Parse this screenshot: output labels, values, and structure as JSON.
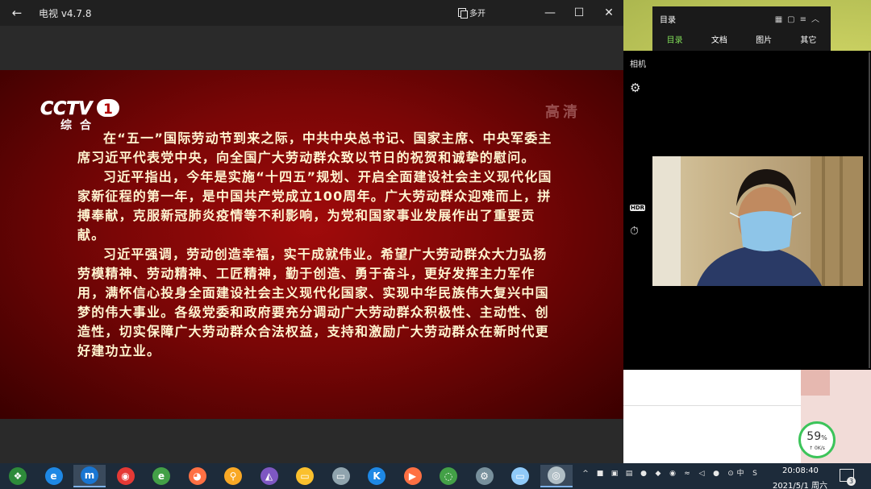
{
  "tv_window": {
    "title": "电视 v4.7.8",
    "back_label": "←",
    "popout_label": "多开",
    "minimize": "—",
    "maximize": "☐",
    "close": "✕"
  },
  "broadcast": {
    "channel_logo": "CCTV 1",
    "channel_sub": "综合",
    "hd_label": "高清",
    "paragraphs": [
      "在“五一”国际劳动节到来之际，中共中央总书记、国家主席、中央军委主席习近平代表党中央，向全国广大劳动群众致以节日的祝贺和诚挚的慰问。",
      "习近平指出，今年是实施“十四五”规划、开启全面建设社会主义现代化国家新征程的第一年，是中国共产党成立100周年。广大劳动群众迎难而上，拼搏奉献，克服新冠肺炎疫情等不利影响，为党和国家事业发展作出了重要贡献。",
      "习近平强调，劳动创造幸福，实干成就伟业。希望广大劳动群众大力弘扬劳模精神、劳动精神、工匠精神，勤于创造、勇于奋斗，更好发挥主力军作用，满怀信心投身全面建设社会主义现代化国家、实现中华民族伟大复兴中国梦的伟大事业。各级党委和政府要充分调动广大劳动群众积极性、主动性、创造性，切实保障广大劳动群众合法权益，支持和激励广大劳动群众在新时代更好建功立业。"
    ]
  },
  "directory_panel": {
    "title": "目录",
    "tabs": [
      "目录",
      "文档",
      "图片",
      "其它"
    ],
    "active_tab": "目录"
  },
  "camera": {
    "title": "相机",
    "hdr_label": "HDR"
  },
  "net_speed": {
    "percent": "59",
    "percent_unit": "%",
    "rate": "↑ 0K/s"
  },
  "taskbar": {
    "apps": [
      {
        "name": "start",
        "color": "#2e8b3a"
      },
      {
        "name": "ie",
        "color": "#1e88e5"
      },
      {
        "name": "maxthon",
        "color": "#1976d2"
      },
      {
        "name": "chrome",
        "color": "#e53935"
      },
      {
        "name": "360",
        "color": "#43a047"
      },
      {
        "name": "firefox",
        "color": "#ff7043"
      },
      {
        "name": "search",
        "color": "#f9a825"
      },
      {
        "name": "vs",
        "color": "#7e57c2"
      },
      {
        "name": "folder",
        "color": "#fbc02d"
      },
      {
        "name": "tv",
        "color": "#90a4ae"
      },
      {
        "name": "kugou",
        "color": "#1e88e5"
      },
      {
        "name": "video",
        "color": "#ff7043"
      },
      {
        "name": "wechat",
        "color": "#43a047"
      },
      {
        "name": "settings",
        "color": "#78909c"
      },
      {
        "name": "computer",
        "color": "#90caf9"
      },
      {
        "name": "camera",
        "color": "#b0bec5"
      }
    ],
    "clock_time": "20:08:40",
    "clock_date": "2021/5/1  周六",
    "ime": "中",
    "notification_count": "3"
  }
}
